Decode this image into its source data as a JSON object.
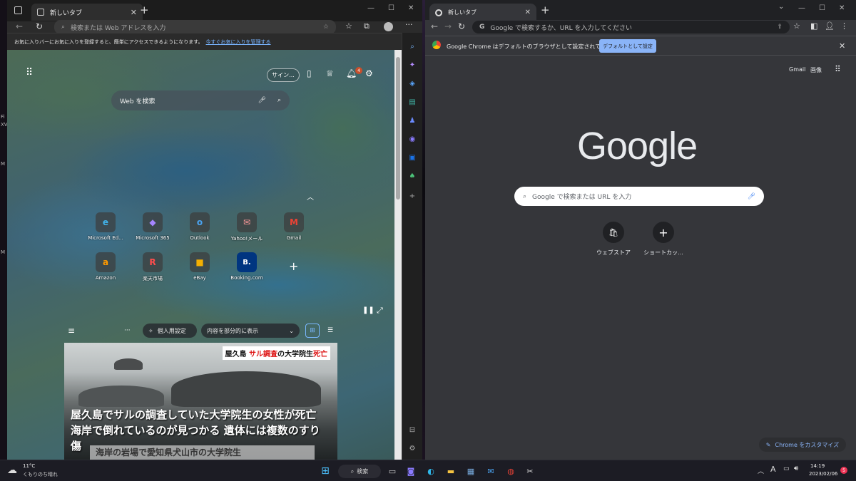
{
  "desktop": {
    "labels": [
      "Fi",
      "XV",
      "M",
      "M"
    ]
  },
  "edge": {
    "tab_title": "新しいタブ",
    "address_placeholder": "検索または Web アドレスを入力",
    "fav_bar_text": "お気に入りバーにお気に入りを登録すると、簡単にアクセスできるようになります。",
    "fav_bar_link": "今すぐお気に入りを管理する",
    "signin_label": "サイン...",
    "notif_count": "4",
    "web_search_placeholder": "Web を検索",
    "tiles": [
      {
        "label": "Microsoft Ed...",
        "icon": "edge-icon",
        "glyph": "e",
        "color": "#2a8fd6"
      },
      {
        "label": "Microsoft 365",
        "icon": "m365-icon",
        "glyph": "◆",
        "color": "#7b61ff"
      },
      {
        "label": "Outlook",
        "icon": "outlook-icon",
        "glyph": "o",
        "color": "#1a73c8"
      },
      {
        "label": "Yahoo!メール",
        "icon": "yahoo-mail-icon",
        "glyph": "✉",
        "color": "#c0392b"
      },
      {
        "label": "Gmail",
        "icon": "gmail-icon",
        "glyph": "M",
        "color": "#d93025"
      },
      {
        "label": "Amazon",
        "icon": "amazon-icon",
        "glyph": "a",
        "color": "#ff9900"
      },
      {
        "label": "楽天市場",
        "icon": "rakuten-icon",
        "glyph": "R",
        "color": "#bf0000"
      },
      {
        "label": "eBay",
        "icon": "ebay-icon",
        "glyph": "■",
        "color": "#e53238"
      },
      {
        "label": "Booking.com",
        "icon": "booking-icon",
        "glyph": "B.",
        "color": "#003580"
      }
    ],
    "feed": {
      "personalize": "個人用設定",
      "view_option": "内容を部分的に表示"
    },
    "news": {
      "caption_a": "屋久島 ",
      "caption_red": "サル調査",
      "caption_b": "の大学院生",
      "caption_red2": "死亡",
      "headline": "屋久島でサルの調査していた大学院生の女性が死亡 海岸で倒れているのが見つかる 遺体には複数のすり傷",
      "subtitle": "海岸の岩場で愛知県犬山市の大学院生"
    }
  },
  "chrome": {
    "tab_title": "新しいタブ",
    "address_placeholder": "Google で検索するか、URL を入力してください",
    "info_text": "Google Chrome はデフォルトのブラウザとして設定されていません",
    "default_button": "デフォルトとして設定",
    "gmail_link": "Gmail",
    "images_link": "画像",
    "logo_text": "Google",
    "search_placeholder": "Google で検索または URL を入力",
    "shortcuts": [
      {
        "label": "ウェブストア"
      },
      {
        "label": "ショートカッ..."
      }
    ],
    "customize_label": "Chrome をカスタマイズ"
  },
  "taskbar": {
    "weather_temp": "11°C",
    "weather_text": "くもりのち晴れ",
    "search_label": "検索",
    "time": "14:19",
    "date": "2023/02/06",
    "ime": "A",
    "notif": "5"
  }
}
